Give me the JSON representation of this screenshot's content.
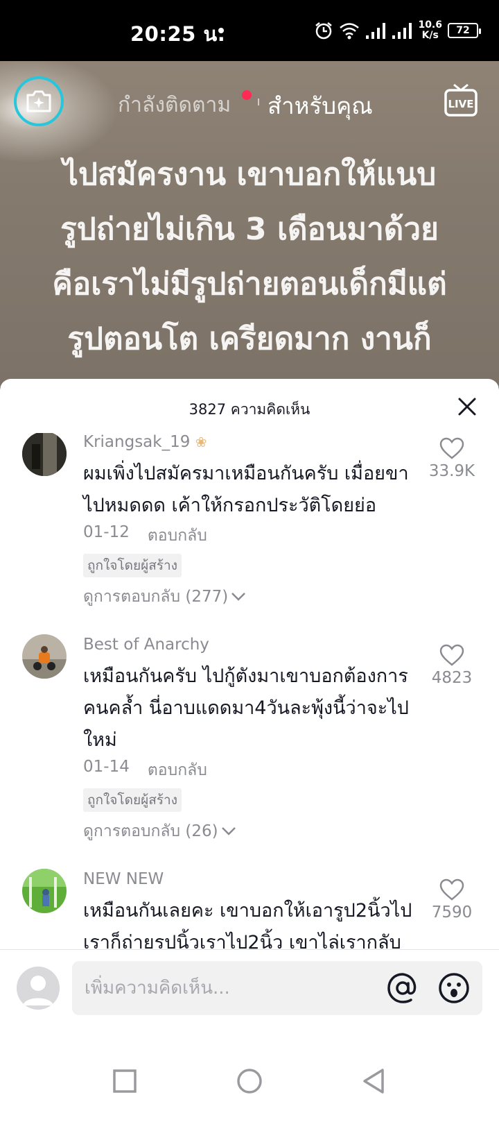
{
  "status_bar": {
    "time": "20:25 น.",
    "net_speed_value": "10.6",
    "net_speed_unit": "K/s",
    "battery": "72",
    "icons": [
      "alarm-icon",
      "wifi-icon",
      "signal-icon",
      "signal-icon"
    ]
  },
  "top_nav": {
    "following_label": "กำลังติดตาม",
    "foryou_label": "สำหรับคุณ",
    "live_label": "LIVE",
    "accent_color": "#fe2c55"
  },
  "video": {
    "caption": "ไปสมัครงาน เขาบอกให้แนบ\nรูปถ่ายไม่เกิน 3 เดือนมาด้วย\nคือเราไม่มีรูปถ่ายตอนเด็กมีแต่\nรูปตอนโต เครียดมาก งานก็"
  },
  "comments_panel": {
    "header": "3827 ความคิดเห็น",
    "comments": [
      {
        "username": "Kriangsak_19",
        "text": "ผมเพิ่งไปสมัครมาเหมือนกันครับ เมื่อยขาไปหมดดด เค้าให้กรอกประวัติโดยย่อ",
        "date": "01-12",
        "reply_label": "ตอบกลับ",
        "creator_badge": "ถูกใจโดยผู้สร้าง",
        "view_replies": "ดูการตอบกลับ (277)",
        "likes": "33.9K"
      },
      {
        "username": "Best of Anarchy",
        "text": "เหมือนกันครับ ไปกู้ตังมาเขาบอกต้องการคนคล้ำ นี่อาบแดดมา4วันละพุ้งนี้ว่าจะไปใหม่",
        "date": "01-14",
        "reply_label": "ตอบกลับ",
        "creator_badge": "ถูกใจโดยผู้สร้าง",
        "view_replies": "ดูการตอบกลับ (26)",
        "likes": "4823"
      },
      {
        "username": "NEW NEW",
        "text": "เหมือนกันเลยคะ เขาบอกให้เอารูป2นิ้วไป เราก็ถ่ายรูปนิ้วเราไป2นิ้ว เขาไล่เรากลับเลยคะ งงเลยผิดตรงไหน",
        "likes": "7590"
      }
    ]
  },
  "input_bar": {
    "placeholder": "เพิ่มความคิดเห็น..."
  }
}
